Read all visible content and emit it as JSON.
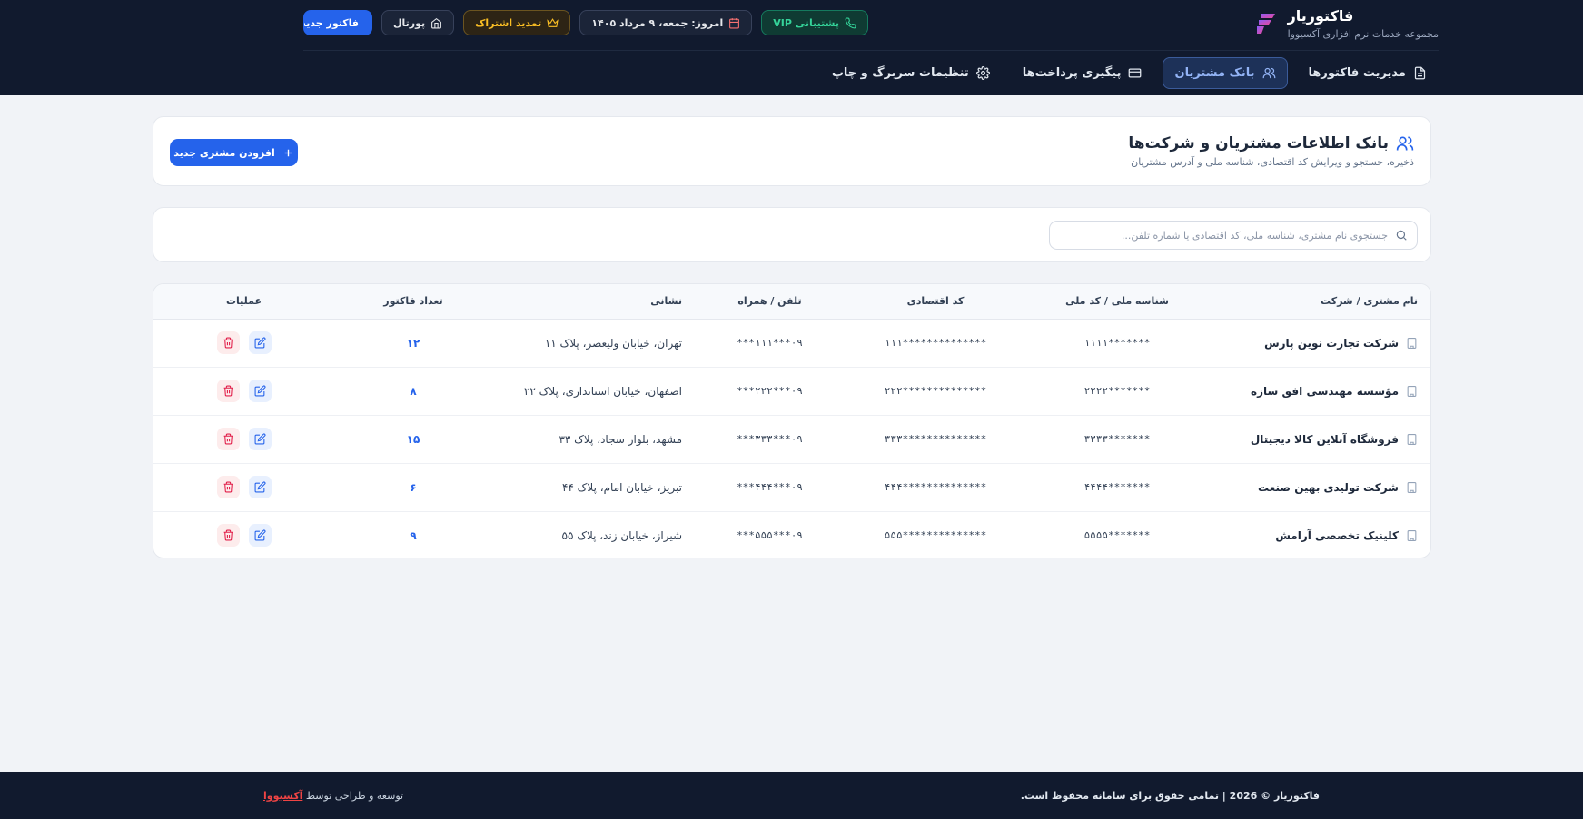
{
  "brand": {
    "title": "فاکتوریار",
    "subtitle": "مجموعه خدمات نرم افزاری آکسیووا"
  },
  "actions": {
    "vip_label": "پشتیبانی VIP",
    "date_label": "امروز: جمعه، ۹ مرداد ۱۴۰۵",
    "renew_label": "تمدید اشتراک",
    "portal_label": "پورتال",
    "new_invoice_label": "فاکتور جدید"
  },
  "nav": {
    "items": [
      {
        "label": "مدیریت فاکتورها",
        "icon": "document-icon",
        "active": false
      },
      {
        "label": "بانک مشتریان",
        "icon": "users-icon",
        "active": true
      },
      {
        "label": "پیگیری پرداخت‌ها",
        "icon": "card-icon",
        "active": false
      },
      {
        "label": "تنظیمات سربرگ و چاپ",
        "icon": "gear-icon",
        "active": false
      }
    ]
  },
  "header_card": {
    "title": "بانک اطلاعات مشتریان و شرکت‌ها",
    "subtitle": "ذخیره، جستجو و ویرایش کد اقتصادی، شناسه ملی و آدرس مشتریان",
    "add_button": "افزودن مشتری جدید"
  },
  "search": {
    "placeholder": "جستجوی نام مشتری، شناسه ملی، کد اقتصادی یا شماره تلفن...",
    "value": ""
  },
  "table": {
    "headers": [
      "نام مشتری / شرکت",
      "شناسه ملی / کد ملی",
      "کد اقتصادی",
      "تلفن / همراه",
      "نشانی",
      "تعداد فاکتور",
      "عملیات"
    ],
    "rows": [
      {
        "name": "شرکت تجارت نوین پارس",
        "national_id": "*******۱۱۱۱",
        "economic_code": "**************۱۱۱",
        "phone": "۰۹***۱۱۱***",
        "address": "تهران، خیابان ولیعصر، پلاک ۱۱",
        "count": "۱۲"
      },
      {
        "name": "مؤسسه مهندسی افق سازه",
        "national_id": "*******۲۲۲۲",
        "economic_code": "**************۲۲۲",
        "phone": "۰۹***۲۲۲***",
        "address": "اصفهان، خیابان استانداری، پلاک ۲۲",
        "count": "۸"
      },
      {
        "name": "فروشگاه آنلاین کالا دیجیتال",
        "national_id": "*******۳۳۳۳",
        "economic_code": "**************۳۳۳",
        "phone": "۰۹***۳۳۳***",
        "address": "مشهد، بلوار سجاد، پلاک ۳۳",
        "count": "۱۵"
      },
      {
        "name": "شرکت تولیدی بهین صنعت",
        "national_id": "*******۴۴۴۴",
        "economic_code": "**************۴۴۴",
        "phone": "۰۹***۴۴۴***",
        "address": "تبریز، خیابان امام، پلاک ۴۴",
        "count": "۶"
      },
      {
        "name": "کلینیک تخصصی آرامش",
        "national_id": "*******۵۵۵۵",
        "economic_code": "**************۵۵۵",
        "phone": "۰۹***۵۵۵***",
        "address": "شیراز، خیابان زند، پلاک ۵۵",
        "count": "۹"
      }
    ]
  },
  "footer": {
    "copyright": "فاکتوریار © 2026 | تمامی حقوق برای سامانه محفوظ است.",
    "credit_prefix": "توسعه و طراحی توسط",
    "credit_brand": "آکسیووا"
  },
  "colors": {
    "primary": "#2563eb",
    "dark_bg": "#111a2e",
    "danger": "#ef4444",
    "success": "#34d399",
    "warning": "#fbbf24"
  }
}
